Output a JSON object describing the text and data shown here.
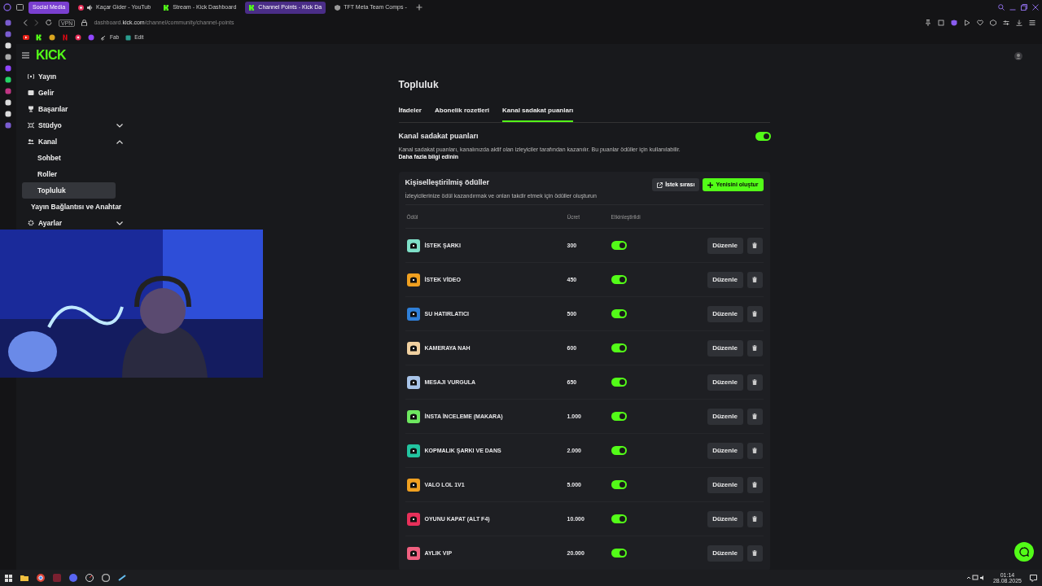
{
  "browser": {
    "tabs": [
      {
        "label": "Social Media",
        "kind": "group",
        "selected": false
      },
      {
        "label": "Kaçar Gider - YouTub",
        "kind": "youtube",
        "selected": false
      },
      {
        "label": "Stream - Kick Dashboard",
        "kind": "kick",
        "selected": false
      },
      {
        "label": "Channel Points - Kick Da",
        "kind": "kick",
        "selected": true
      },
      {
        "label": "TFT Meta Team Comps -",
        "kind": "site",
        "selected": false
      }
    ],
    "url_host": "dashboard.",
    "url_domain": "kick.com",
    "url_path": "/channel/community/channel-points",
    "vpn": "VPN",
    "bookmarks": [
      {
        "label": "Fab"
      },
      {
        "label": "Edit"
      }
    ]
  },
  "logo": "KICK",
  "sidebar": {
    "items": [
      {
        "label": "Yayın",
        "kind": "link",
        "selected": false
      },
      {
        "label": "Gelir",
        "kind": "link",
        "selected": false
      },
      {
        "label": "Başarılar",
        "kind": "link",
        "selected": false
      },
      {
        "label": "Stüdyo",
        "kind": "group",
        "expanded": false,
        "selected": false
      },
      {
        "label": "Kanal",
        "kind": "group",
        "expanded": true,
        "selected": false,
        "children": [
          {
            "label": "Sohbet",
            "selected": false
          },
          {
            "label": "Roller",
            "selected": false
          },
          {
            "label": "Topluluk",
            "selected": true
          }
        ]
      },
      {
        "label": "Yayın Bağlantısı ve Anahtar",
        "kind": "plain",
        "selected": false
      },
      {
        "label": "Ayarlar",
        "kind": "group",
        "expanded": false,
        "selected": false
      }
    ]
  },
  "page": {
    "title": "Topluluk",
    "tabs": [
      {
        "label": "İfadeler",
        "selected": false
      },
      {
        "label": "Abonelik rozetleri",
        "selected": false
      },
      {
        "label": "Kanal sadakat puanları",
        "selected": true
      }
    ],
    "section": {
      "title": "Kanal sadakat puanları",
      "on": true,
      "description": "Kanal sadakat puanları, kanalınızda aktif olan izleyiciler tarafından kazanılır. Bu puanlar ödüller için kullanılabilir.",
      "link": "Daha fazla bilgi edinin"
    },
    "rewards": {
      "title": "Kişiselleştirilmiş ödüller",
      "subtitle": "İzleyicilerinize ödül kazandırmak ve onları takdir etmek için ödüller oluşturun",
      "buttons": [
        {
          "label": "İstek sırası",
          "kind": "secondary"
        },
        {
          "label": "Yenisini oluştur",
          "kind": "primary"
        }
      ],
      "columns": [
        "Ödül",
        "Ücret",
        "Etkinleştirildi"
      ],
      "rows": [
        {
          "name": "İSTEK ŞARKI",
          "cost": "300",
          "enabled": true,
          "color": "#7fe0c8",
          "edit": "Düzenle"
        },
        {
          "name": "İSTEK VİDEO",
          "cost": "450",
          "enabled": true,
          "color": "#f0a020",
          "edit": "Düzenle"
        },
        {
          "name": "SU HATIRLATICI",
          "cost": "500",
          "enabled": true,
          "color": "#2f7fd8",
          "edit": "Düzenle"
        },
        {
          "name": "KAMERAYA NAH",
          "cost": "600",
          "enabled": true,
          "color": "#f0d0a0",
          "edit": "Düzenle"
        },
        {
          "name": "MESAJI VURGULA",
          "cost": "650",
          "enabled": true,
          "color": "#a8c4e8",
          "edit": "Düzenle"
        },
        {
          "name": "İNSTA İNCELEME (MAKARA)",
          "cost": "1.000",
          "enabled": true,
          "color": "#6ee860",
          "edit": "Düzenle"
        },
        {
          "name": "KOPMALIK ŞARKI VE DANS",
          "cost": "2.000",
          "enabled": true,
          "color": "#22c4a0",
          "edit": "Düzenle"
        },
        {
          "name": "VALO LOL 1V1",
          "cost": "5.000",
          "enabled": true,
          "color": "#f0a020",
          "edit": "Düzenle"
        },
        {
          "name": "OYUNU KAPAT (ALT F4)",
          "cost": "10.000",
          "enabled": true,
          "color": "#e8305a",
          "edit": "Düzenle"
        },
        {
          "name": "AYLIK VIP",
          "cost": "20.000",
          "enabled": true,
          "color": "#f06080",
          "edit": "Düzenle"
        }
      ]
    }
  },
  "taskbar": {
    "time": "01:14",
    "date": "28.08.2025"
  }
}
